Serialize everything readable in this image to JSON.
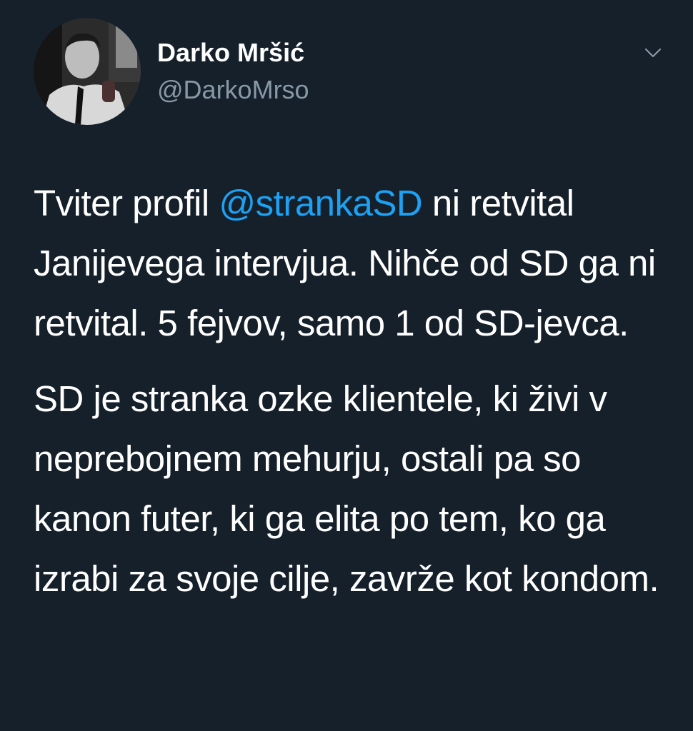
{
  "author": {
    "name": "Darko Mršić",
    "handle": "@DarkoMrso"
  },
  "icons": {
    "more": "chevron-down-icon",
    "avatar": "profile-photo"
  },
  "colors": {
    "background": "#15202b",
    "text": "#ffffff",
    "secondary_text": "#8899a6",
    "link": "#1da1f2"
  },
  "tweet": {
    "paragraph1": {
      "before": "Tviter profil ",
      "mention": "@strankaSD",
      "after": " ni retvital Janijevega intervjua. Nihče od SD ga ni retvital. 5 fejvov, samo 1 od SD-jevca."
    },
    "paragraph2": "SD je stranka ozke klientele, ki živi v neprebojnem mehurju, ostali pa so  kanon futer, ki ga elita po tem, ko ga izrabi za svoje cilje, zavrže kot kondom."
  }
}
